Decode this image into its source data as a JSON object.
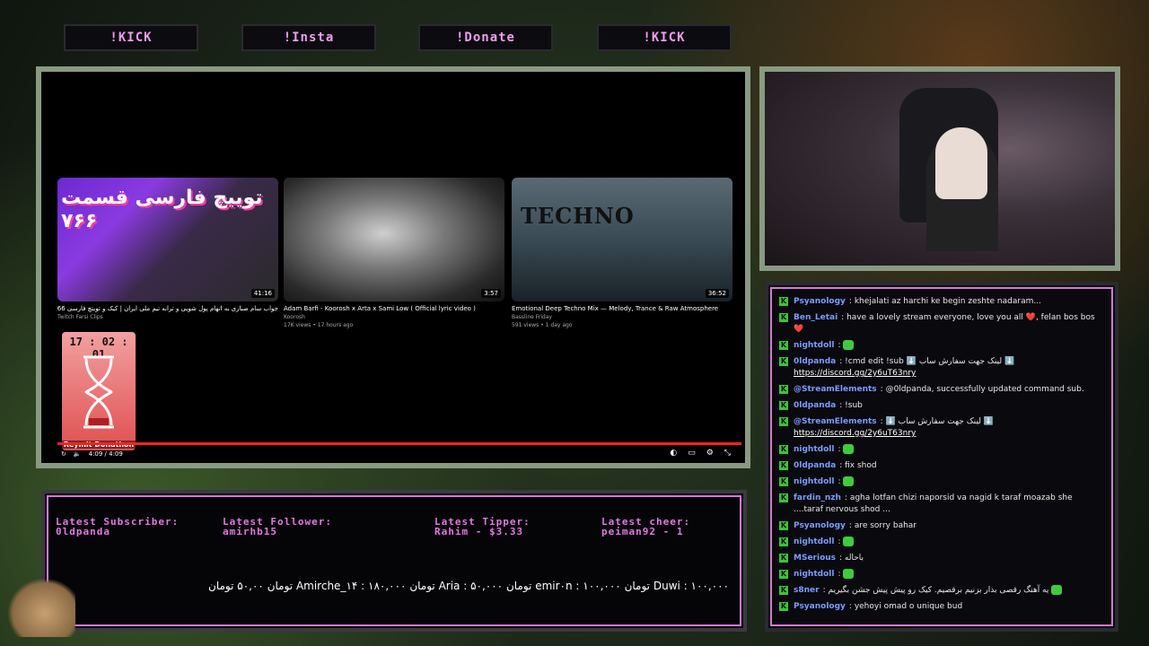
{
  "nav": [
    "!KICK",
    "!Insta",
    "!Donate",
    "!KICK"
  ],
  "player": {
    "cards": [
      {
        "title": "جواب سام صباری به اتهام پول شویی و ترانه تیم ملی ایران | کیک و تویتچ فارسی 766 ❄️",
        "channel": "Twitch Farsi Clips",
        "meta": "",
        "duration": "41:16",
        "overlay": "توییچ فارسی قسمت ۷۶۶"
      },
      {
        "title": "Adam Barfi - Koorosh x Arta x Sami Low ( Official lyric video )",
        "channel": "Koorosh",
        "meta": "17K views • 17 hours ago",
        "duration": "3:57",
        "overlay": ""
      },
      {
        "title": "Emotional Deep Techno Mix — Melody, Trance & Raw Atmosphere",
        "channel": "Bassline Friday",
        "meta": "591 views • 1 day ago",
        "duration": "36:52",
        "overlay": "TECHNO"
      }
    ],
    "time": "4:09 / 4:09",
    "timer": "17 : 02 : 01",
    "timer_label": "Reymit Donathon"
  },
  "chat": [
    {
      "user": "Psyanology",
      "color": "#7a9cff",
      "text": "khejalati az harchi ke begin zeshte nadaram..."
    },
    {
      "user": "Ben_Letai",
      "color": "#7a9cff",
      "text": "have a lovely stream everyone, love you all ❤️, felan bos bos ❤️"
    },
    {
      "user": "nightdoll",
      "color": "#7a9cff",
      "text": "",
      "emote": true
    },
    {
      "user": "0ldpanda",
      "color": "#7a9cff",
      "text": "!cmd edit !sub ⬇️ لینک جهت سفارش ساب ⬇️",
      "link": "https://discord.gg/2y6uT63nry"
    },
    {
      "user": "@StreamElements",
      "color": "#7a9cff",
      "text": "@0ldpanda, successfully updated command sub."
    },
    {
      "user": "0ldpanda",
      "color": "#7a9cff",
      "text": "!sub"
    },
    {
      "user": "@StreamElements",
      "color": "#7a9cff",
      "text": "⬇️ لینک جهت سفارش ساب ⬇️",
      "link": "https://discord.gg/2y6uT63nry"
    },
    {
      "user": "nightdoll",
      "color": "#7a9cff",
      "text": "",
      "emote": true
    },
    {
      "user": "0ldpanda",
      "color": "#7a9cff",
      "text": "fix shod"
    },
    {
      "user": "nightdoll",
      "color": "#7a9cff",
      "text": "",
      "emote": true
    },
    {
      "user": "fardin_nzh",
      "color": "#7a9cff",
      "text": "agha lotfan chizi naporsid va nagid k taraf moazab she ....taraf nervous shod ..."
    },
    {
      "user": "Psyanology",
      "color": "#7a9cff",
      "text": "are sorry bahar"
    },
    {
      "user": "nightdoll",
      "color": "#7a9cff",
      "text": "",
      "emote": true
    },
    {
      "user": "MSerious",
      "color": "#7a9cff",
      "text": "باحاله"
    },
    {
      "user": "nightdoll",
      "color": "#7a9cff",
      "text": "",
      "emote": true
    },
    {
      "user": "s8ner",
      "color": "#7a9cff",
      "text": "یه آهنگ رقصی بذار بزنیم برقصیم. کیک رو پیش پیش جشن بگیریم",
      "emote": true
    },
    {
      "user": "Psyanology",
      "color": "#7a9cff",
      "text": "yehoyi omad o unique bud"
    }
  ],
  "info": {
    "latest_subscriber_label": "Latest Subscriber:",
    "latest_subscriber": "0ldpanda",
    "latest_follower_label": "Latest Follower:",
    "latest_follower": "amirhb15",
    "latest_tipper_label": "Latest Tipper:",
    "latest_tipper": "Rahim - $3.33",
    "latest_cheer_label": "Latest cheer:",
    "latest_cheer": "peiman92 - 1",
    "ticker": "Duwi : ۱۰۰,۰۰۰ تومان     emir۰n : ۱۰۰,۰۰۰ تومان     Aria : ۵۰,۰۰۰ تومان     Amirche_۱۴ : ۱۸۰,۰۰۰ تومان     ۵۰,۰۰ تومان"
  }
}
